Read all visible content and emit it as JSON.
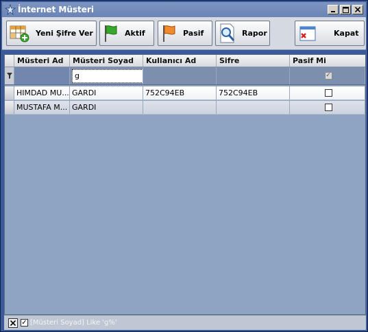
{
  "window": {
    "title": "İnternet Müsteri"
  },
  "toolbar": {
    "new_password": "Yeni Şifre Ver",
    "active": "Aktif",
    "passive": "Pasif",
    "report": "Rapor",
    "close": "Kapat"
  },
  "grid": {
    "columns": [
      "Müsteri Ad",
      "Müsteri Soyad",
      "Kullanıcı Ad",
      "Sifre",
      "Pasif Mi"
    ],
    "filter": {
      "musteri_soyad": "g"
    },
    "rows": [
      {
        "musteri_ad": "HIMDAD MU...",
        "musteri_soyad": "GARDI",
        "kullanici_ad": "752C94EB",
        "sifre": "752C94EB",
        "pasif_mi": false
      },
      {
        "musteri_ad": "MUSTAFA M...",
        "musteri_soyad": "GARDI",
        "kullanici_ad": "",
        "sifre": "",
        "pasif_mi": false
      }
    ]
  },
  "filter_panel": {
    "expression": "[Müsteri Soyad] Like 'g%'"
  }
}
